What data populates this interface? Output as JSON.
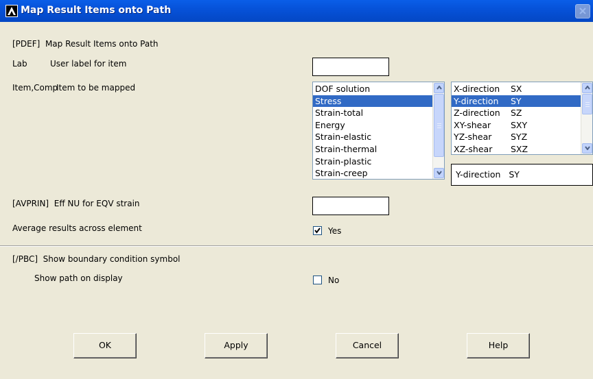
{
  "window": {
    "title": "Map Result Items onto Path",
    "close_label": "close"
  },
  "header": {
    "command": "[PDEF]  Map Result Items onto Path"
  },
  "lab": {
    "key": "Lab",
    "label": "User label for item",
    "value": ""
  },
  "item": {
    "key": "Item,Comp",
    "label": "Item to be mapped",
    "list_left": [
      "DOF solution",
      "Stress",
      "Strain-total",
      "Energy",
      "Strain-elastic",
      "Strain-thermal",
      "Strain-plastic",
      "Strain-creep"
    ],
    "selected_left": "Stress",
    "list_right": [
      {
        "name": "X-direction",
        "code": "SX"
      },
      {
        "name": "Y-direction",
        "code": "SY"
      },
      {
        "name": "Z-direction",
        "code": "SZ"
      },
      {
        "name": "XY-shear",
        "code": "SXY"
      },
      {
        "name": "YZ-shear",
        "code": "SYZ"
      },
      {
        "name": "XZ-shear",
        "code": "SXZ"
      }
    ],
    "selected_right": "Y-direction",
    "selection_value": "Y-direction   SY"
  },
  "avprin": {
    "label": "[AVPRIN]  Eff NU for EQV strain",
    "value": ""
  },
  "average": {
    "label": "Average results across element",
    "checked": true,
    "state_label": "Yes"
  },
  "pbc": {
    "label": "[/PBC]  Show boundary condition symbol",
    "sublabel": "Show path on display",
    "checked": false,
    "state_label": "No"
  },
  "buttons": {
    "ok": "OK",
    "apply": "Apply",
    "cancel": "Cancel",
    "help": "Help"
  },
  "colors": {
    "titlebar": "#0652d9",
    "selection": "#316ac5",
    "dialog_bg": "#ece9d8"
  }
}
